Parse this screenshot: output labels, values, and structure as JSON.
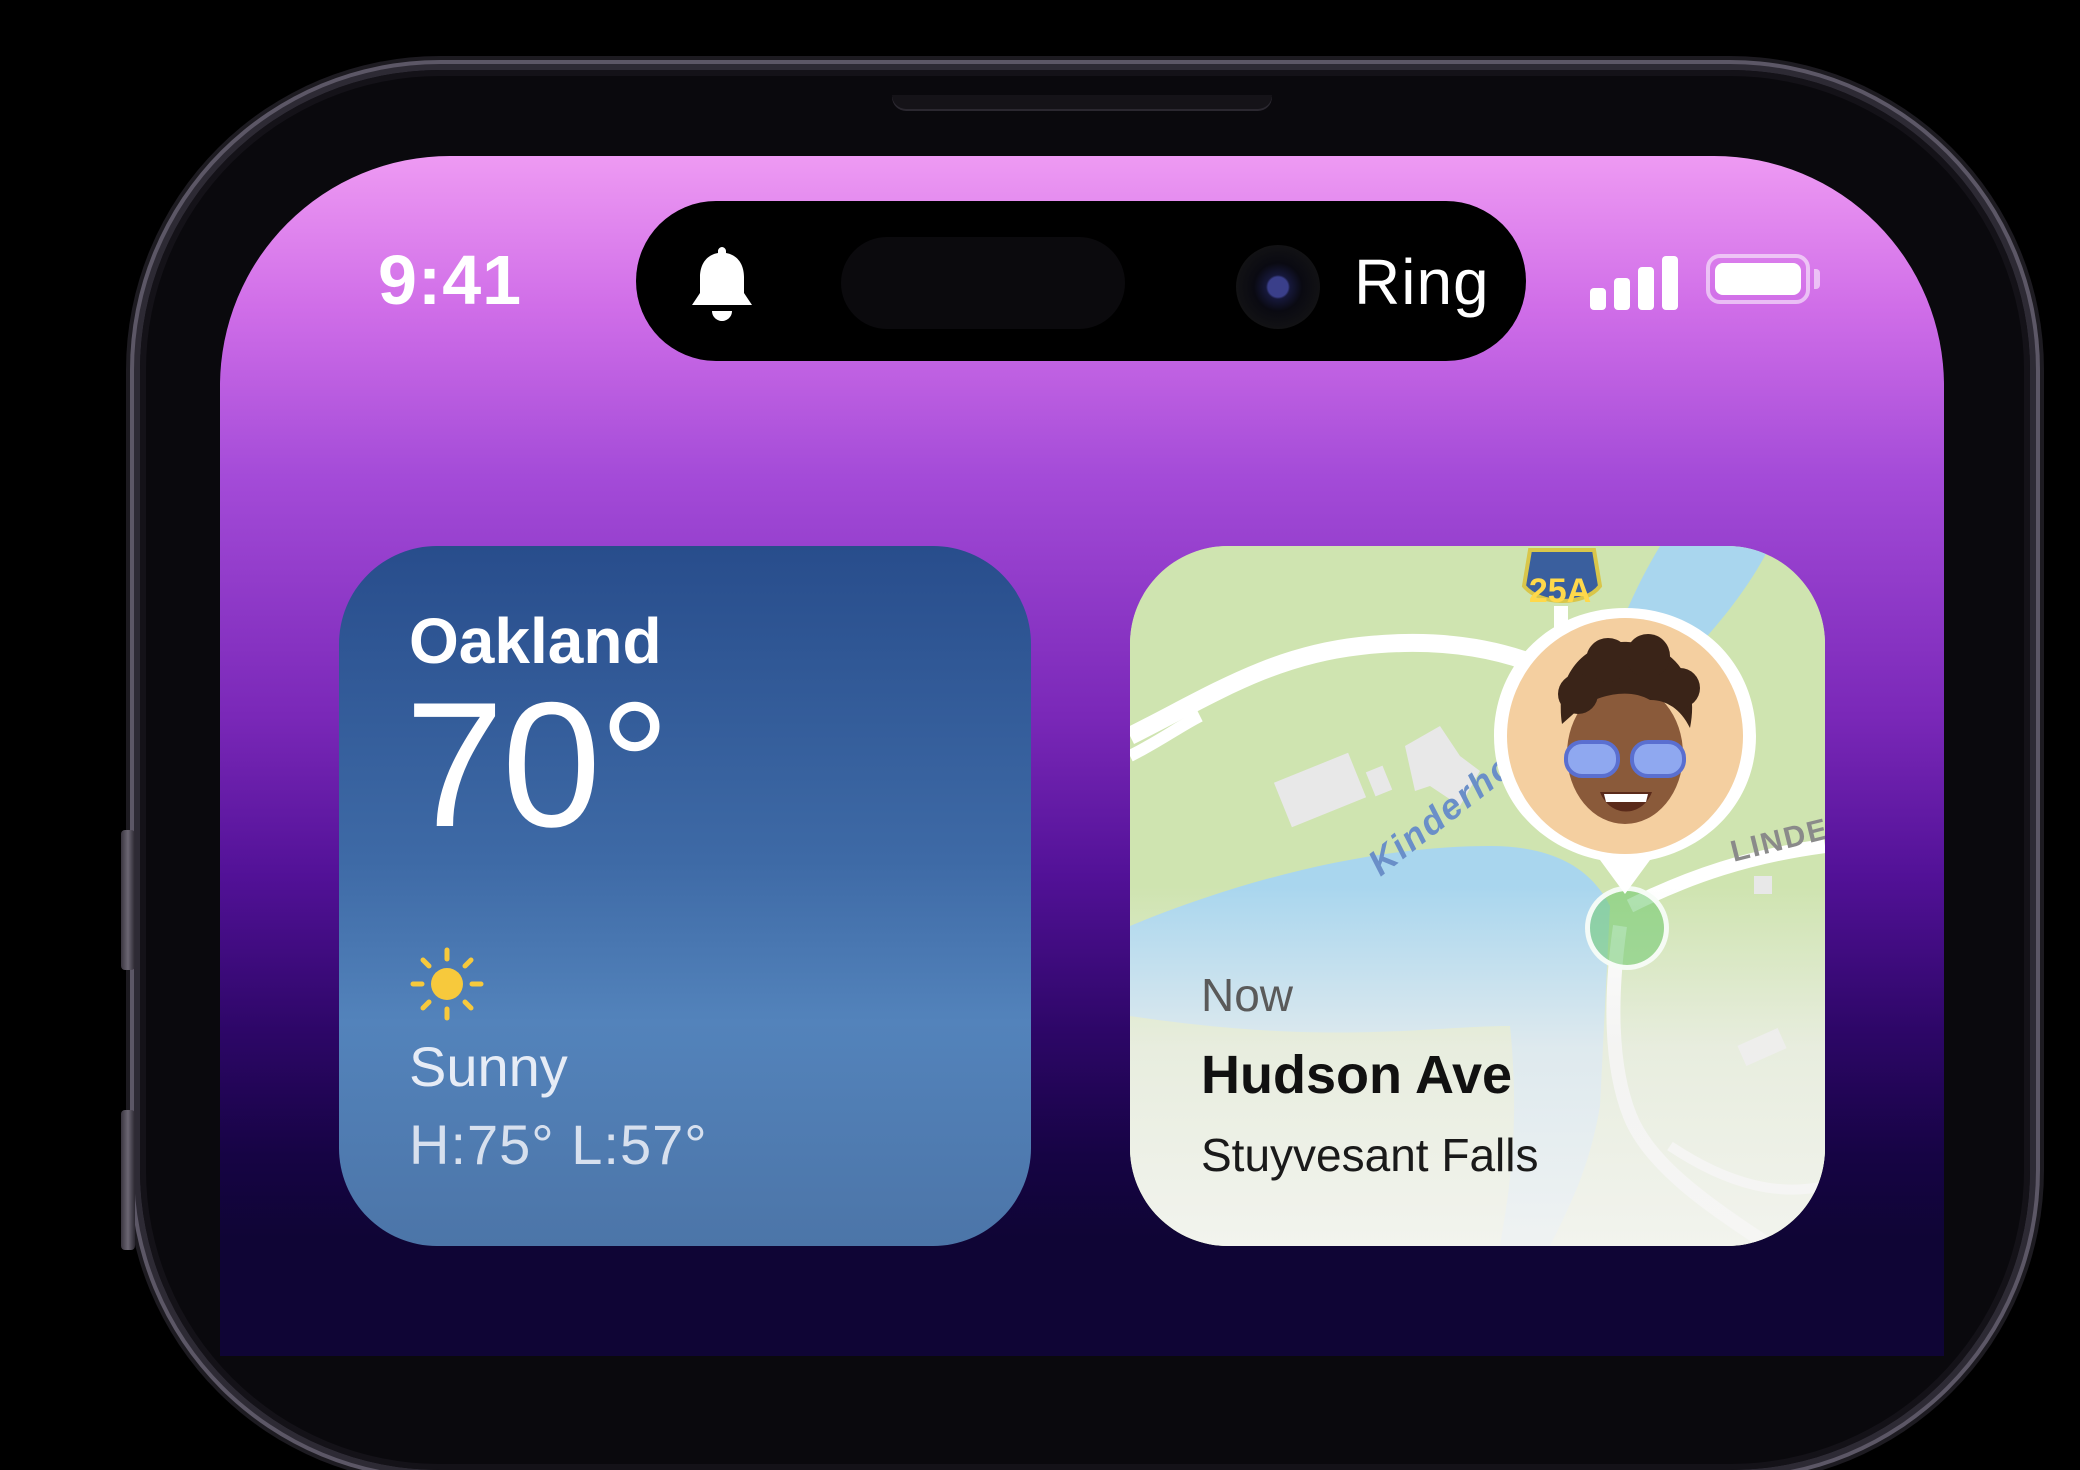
{
  "status_bar": {
    "time": "9:41",
    "signal_bars": 4,
    "battery_level": 1.0
  },
  "dynamic_island": {
    "icon": "bell-icon",
    "label": "Ring"
  },
  "weather_widget": {
    "city": "Oakland",
    "temperature": "70°",
    "condition_icon": "sun-icon",
    "condition": "Sunny",
    "high_low": "H:75° L:57°"
  },
  "find_my_widget": {
    "route_shield": "25A",
    "river_label": "Kinderhoo",
    "road_label": "LINDE",
    "time": "Now",
    "street": "Hudson Ave",
    "area": "Stuyvesant Falls"
  },
  "colors": {
    "wallpaper_top": "#ee9af3",
    "wallpaper_bottom": "#0f0535",
    "weather_bg": "#3e6aa6",
    "map_land": "#cfe4b0",
    "map_water": "#a9d6ee"
  }
}
